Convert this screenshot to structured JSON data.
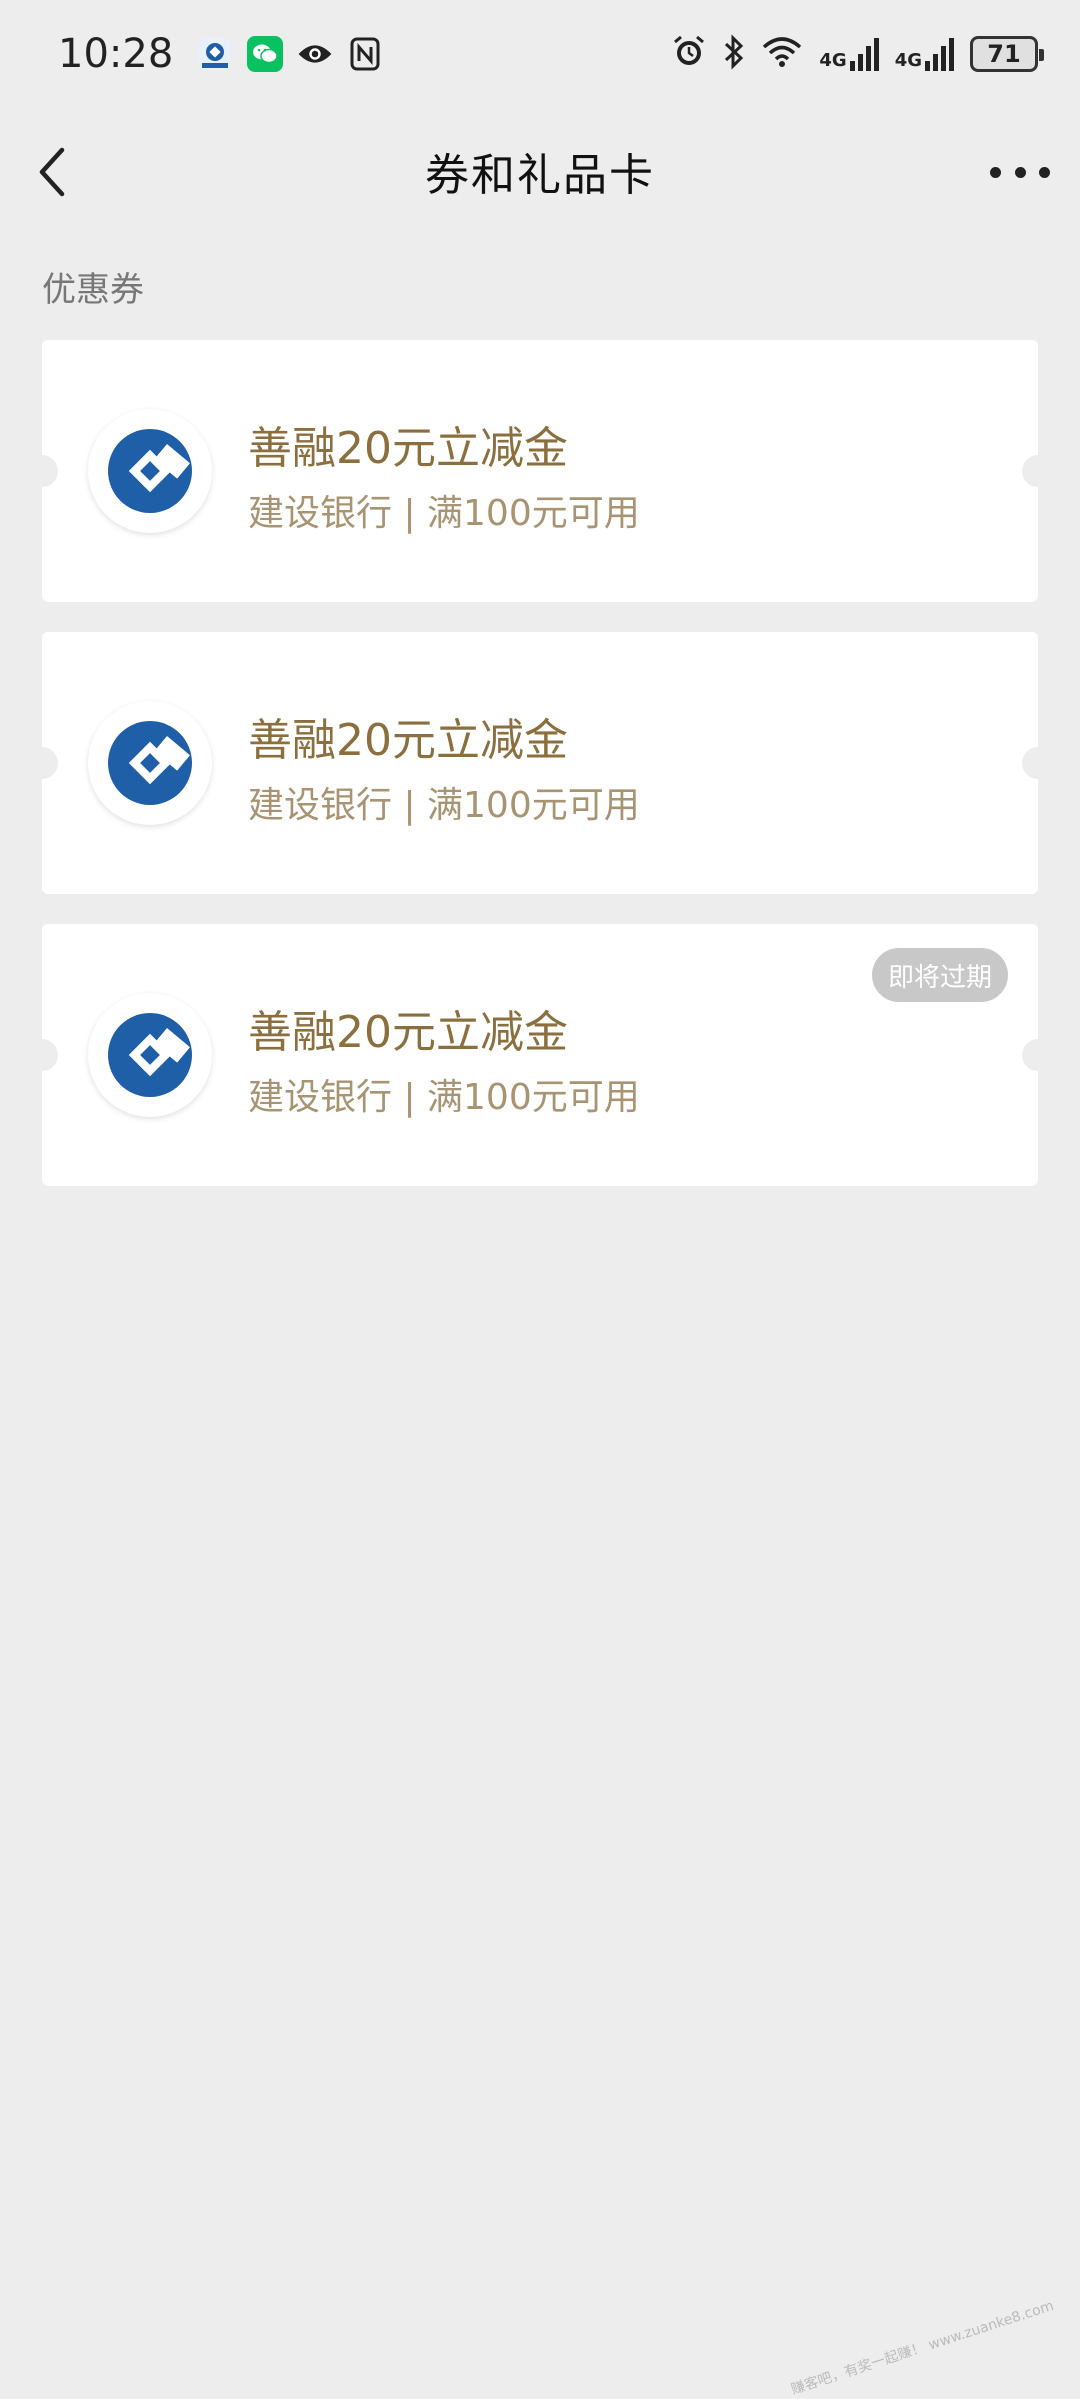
{
  "status_bar": {
    "time": "10:28",
    "left_icons": [
      "ccb-app-icon",
      "wechat-icon",
      "eye-icon",
      "nfc-icon"
    ],
    "right_icons": [
      "alarm-icon",
      "bluetooth-icon",
      "wifi-icon",
      "signal-4g-icon",
      "signal-4g-icon"
    ],
    "signal_label_1": "4G",
    "signal_label_2": "4G",
    "battery": "71"
  },
  "nav": {
    "title": "券和礼品卡",
    "back_icon": "chevron-left-icon",
    "more_icon": "more-dots-icon"
  },
  "section": {
    "label": "优惠券"
  },
  "coupons": [
    {
      "title": "善融20元立减金",
      "subtitle": "建设银行 | 满100元可用",
      "badge": ""
    },
    {
      "title": "善融20元立减金",
      "subtitle": "建设银行 | 满100元可用",
      "badge": ""
    },
    {
      "title": "善融20元立减金",
      "subtitle": "建设银行 | 满100元可用",
      "badge": "即将过期"
    }
  ],
  "colors": {
    "background": "#ededed",
    "card": "#ffffff",
    "title_gold": "#8b6f3e",
    "subtitle_gold": "#a89472",
    "ccb_blue": "#1f5fa8",
    "badge_gray": "#c8c8c8"
  },
  "watermark": "赚客吧，有奖一起赚！ www.zuanke8.com"
}
